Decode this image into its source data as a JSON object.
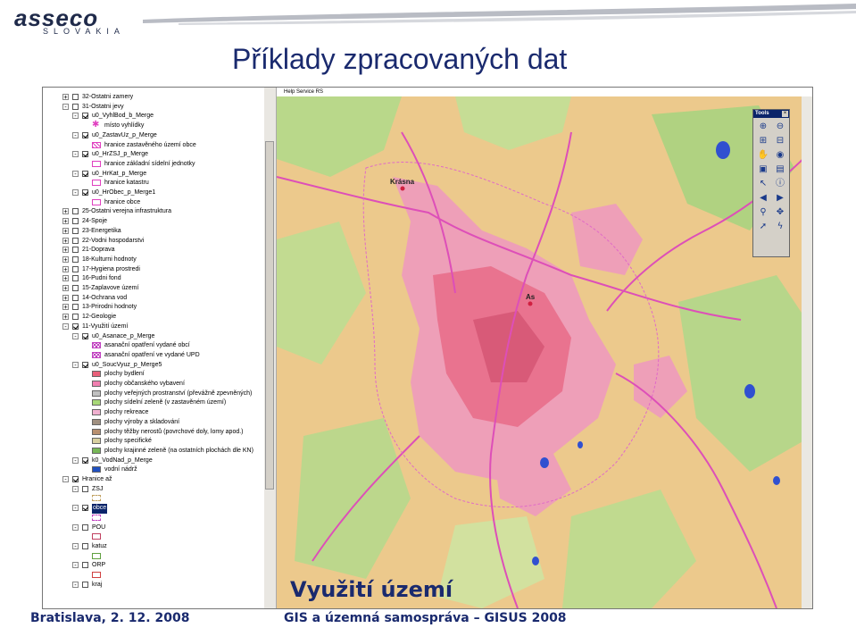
{
  "header": {
    "logo_text": "asseco",
    "logo_sub": "SLOVAKIA",
    "title": "Příklady zpracovaných dat"
  },
  "map_window": {
    "toolbar_text": "Help  Service  RS",
    "tools_title": "Tools",
    "places": {
      "krasna": "Krásna",
      "as": "As"
    }
  },
  "legend": [
    {
      "indent": 1,
      "pm": "+",
      "cb": false,
      "swatch": null,
      "label": "32-Ostatni zamery"
    },
    {
      "indent": 1,
      "pm": "-",
      "cb": false,
      "swatch": null,
      "label": "31-Ostatni jevy"
    },
    {
      "indent": 2,
      "pm": "-",
      "cb": true,
      "swatch": null,
      "label": "u0_VyhlBod_b_Merge"
    },
    {
      "indent": 3,
      "pm": "",
      "cb": null,
      "swatch": "star",
      "color": "#e040c0",
      "label": "místo vyhlídky"
    },
    {
      "indent": 2,
      "pm": "-",
      "cb": true,
      "swatch": null,
      "label": "u0_ZastavUz_p_Merge"
    },
    {
      "indent": 3,
      "pm": "",
      "cb": null,
      "swatch": "hatch",
      "color": "#e040c0",
      "label": "hranice zastavěného území obce"
    },
    {
      "indent": 2,
      "pm": "-",
      "cb": true,
      "swatch": null,
      "label": "u0_HrZSJ_p_Merge"
    },
    {
      "indent": 3,
      "pm": "",
      "cb": null,
      "swatch": "outline",
      "color": "#e040c0",
      "label": "hranice základní sídelní jednotky"
    },
    {
      "indent": 2,
      "pm": "-",
      "cb": true,
      "swatch": null,
      "label": "u0_HrKat_p_Merge"
    },
    {
      "indent": 3,
      "pm": "",
      "cb": null,
      "swatch": "outline",
      "color": "#e040c0",
      "label": "hranice katastru"
    },
    {
      "indent": 2,
      "pm": "-",
      "cb": true,
      "swatch": null,
      "label": "u0_HrObec_p_Merge1"
    },
    {
      "indent": 3,
      "pm": "",
      "cb": null,
      "swatch": "outline",
      "color": "#e040c0",
      "label": "hranice obce"
    },
    {
      "indent": 1,
      "pm": "+",
      "cb": false,
      "swatch": null,
      "label": "25-Ostatni verejna infrastruktura"
    },
    {
      "indent": 1,
      "pm": "+",
      "cb": false,
      "swatch": null,
      "label": "24-Spoje"
    },
    {
      "indent": 1,
      "pm": "+",
      "cb": false,
      "swatch": null,
      "label": "23-Energetika"
    },
    {
      "indent": 1,
      "pm": "+",
      "cb": false,
      "swatch": null,
      "label": "22-Vodni hospodarstvi"
    },
    {
      "indent": 1,
      "pm": "+",
      "cb": false,
      "swatch": null,
      "label": "21-Doprava"
    },
    {
      "indent": 1,
      "pm": "+",
      "cb": false,
      "swatch": null,
      "label": "18-Kulturni hodnoty"
    },
    {
      "indent": 1,
      "pm": "+",
      "cb": false,
      "swatch": null,
      "label": "17-Hygiena prostredi"
    },
    {
      "indent": 1,
      "pm": "+",
      "cb": false,
      "swatch": null,
      "label": "16-Pudni fond"
    },
    {
      "indent": 1,
      "pm": "+",
      "cb": false,
      "swatch": null,
      "label": "15-Zaplavove území"
    },
    {
      "indent": 1,
      "pm": "+",
      "cb": false,
      "swatch": null,
      "label": "14-Ochrana vod"
    },
    {
      "indent": 1,
      "pm": "+",
      "cb": false,
      "swatch": null,
      "label": "13-Prirodni hodnoty"
    },
    {
      "indent": 1,
      "pm": "+",
      "cb": false,
      "swatch": null,
      "label": "12-Geologie"
    },
    {
      "indent": 1,
      "pm": "-",
      "cb": true,
      "swatch": null,
      "label": "11-Využití území"
    },
    {
      "indent": 2,
      "pm": "-",
      "cb": true,
      "swatch": null,
      "label": "u0_Asanace_p_Merge"
    },
    {
      "indent": 3,
      "pm": "",
      "cb": null,
      "swatch": "cross",
      "color": "#c040c0",
      "label": "asanační opatření vydané obcí"
    },
    {
      "indent": 3,
      "pm": "",
      "cb": null,
      "swatch": "cross",
      "color": "#c040c0",
      "label": "asanační opatření ve vydané UPD"
    },
    {
      "indent": 2,
      "pm": "-",
      "cb": true,
      "swatch": null,
      "label": "u0_SoucVyuz_p_Merge5"
    },
    {
      "indent": 3,
      "pm": "",
      "cb": null,
      "swatch": "fill",
      "color": "#e8607a",
      "label": "plochy bydlení"
    },
    {
      "indent": 3,
      "pm": "",
      "cb": null,
      "swatch": "fill",
      "color": "#f080b0",
      "label": "plochy občanského vybavení"
    },
    {
      "indent": 3,
      "pm": "",
      "cb": null,
      "swatch": "fill",
      "color": "#c0c0c0",
      "label": "plochy veřejných prostranství (převážně zpevněných)"
    },
    {
      "indent": 3,
      "pm": "",
      "cb": null,
      "swatch": "fill",
      "color": "#a8d878",
      "label": "plochy sídelní zeleně (v zastavěném území)"
    },
    {
      "indent": 3,
      "pm": "",
      "cb": null,
      "swatch": "fill",
      "color": "#f0b0d0",
      "label": "plochy rekreace"
    },
    {
      "indent": 3,
      "pm": "",
      "cb": null,
      "swatch": "fill",
      "color": "#a09080",
      "label": "plochy výroby a skladování"
    },
    {
      "indent": 3,
      "pm": "",
      "cb": null,
      "swatch": "fill",
      "color": "#b89070",
      "label": "plochy těžby nerostů (povrchové doly, lomy apod.)"
    },
    {
      "indent": 3,
      "pm": "",
      "cb": null,
      "swatch": "fill",
      "color": "#d8d0a0",
      "label": "plochy specifické"
    },
    {
      "indent": 3,
      "pm": "",
      "cb": null,
      "swatch": "fill",
      "color": "#78b858",
      "label": "plochy krajinné zeleně (na ostatních plochách dle KN)"
    },
    {
      "indent": 2,
      "pm": "-",
      "cb": true,
      "swatch": null,
      "label": "k0_VodNad_p_Merge"
    },
    {
      "indent": 3,
      "pm": "",
      "cb": null,
      "swatch": "fill",
      "color": "#2050c0",
      "label": "vodní nádrž"
    },
    {
      "indent": 1,
      "pm": "-",
      "cb": true,
      "swatch": null,
      "label": "Hranice až"
    },
    {
      "indent": 2,
      "pm": "-",
      "cb": false,
      "swatch": null,
      "label": "ZSJ"
    },
    {
      "indent": 3,
      "pm": "",
      "cb": null,
      "swatch": "dashed",
      "color": "#c0a060",
      "label": ""
    },
    {
      "indent": 2,
      "pm": "-",
      "cb": true,
      "swatch": null,
      "label": "obce",
      "selected": true
    },
    {
      "indent": 3,
      "pm": "",
      "cb": null,
      "swatch": "dashed",
      "color": "#c040c0",
      "label": ""
    },
    {
      "indent": 2,
      "pm": "-",
      "cb": false,
      "swatch": null,
      "label": "POU"
    },
    {
      "indent": 3,
      "pm": "",
      "cb": null,
      "swatch": "outline",
      "color": "#c04060",
      "label": ""
    },
    {
      "indent": 2,
      "pm": "-",
      "cb": false,
      "swatch": null,
      "label": "katuz"
    },
    {
      "indent": 3,
      "pm": "",
      "cb": null,
      "swatch": "outline",
      "color": "#60a040",
      "label": ""
    },
    {
      "indent": 2,
      "pm": "-",
      "cb": false,
      "swatch": null,
      "label": "ORP"
    },
    {
      "indent": 3,
      "pm": "",
      "cb": null,
      "swatch": "outline",
      "color": "#d04040",
      "label": ""
    },
    {
      "indent": 2,
      "pm": "-",
      "cb": false,
      "swatch": null,
      "label": "kraj"
    }
  ],
  "caption": "Využití území",
  "footer": {
    "left": "Bratislava, 2. 12. 2008",
    "right": "GIS a územná samospráva – GISUS 2008"
  },
  "tools": [
    "zoom-in-icon",
    "zoom-out-icon",
    "zoom-window-in-icon",
    "zoom-window-out-icon",
    "pan-icon",
    "globe-icon",
    "full-extent-icon",
    "layers-icon",
    "select-icon",
    "info-icon",
    "back-icon",
    "forward-icon",
    "find-icon",
    "xy-icon",
    "pointer-icon",
    "lightning-icon"
  ]
}
